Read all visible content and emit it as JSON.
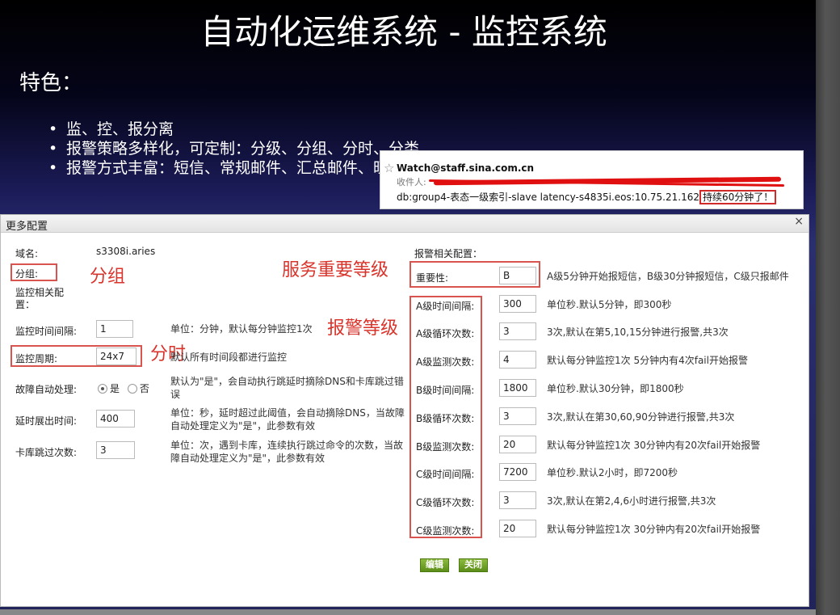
{
  "slide": {
    "title": "自动化运维系统 - 监控系统",
    "feature_heading": "特色：",
    "bullets": [
      "监、控、报分离",
      "报警策略多样化，可定制：分级、分组、分时、分类",
      "报警方式丰富：短信、常规邮件、汇总邮件、旺旺"
    ]
  },
  "email": {
    "star_icon": "star-icon",
    "from": "Watch@staff.sina.com.cn",
    "to_label": "收件人:",
    "body_prefix": "db:group4-表态一级索引-slave latency-s4835i.eos:10.75.21.162",
    "body_highlight": "持续60分钟了！"
  },
  "dialog": {
    "title": "更多配置",
    "close": "×",
    "left": {
      "domain_label": "域名:",
      "domain_value": "s3308i.aries",
      "group_label": "分组:",
      "monitor_section_label": "监控相关配置：",
      "rows": [
        {
          "label": "监控时间间隔:",
          "value": "1",
          "desc": "单位：分钟，默认每分钟监控1次"
        },
        {
          "label": "监控周期:",
          "value": "24x7",
          "desc": "默认所有时间段都进行监控"
        },
        {
          "label": "故障自动处理:",
          "radio_yes": "是",
          "radio_no": "否",
          "desc": "默认为\"是\"，会自动执行跳延时摘除DNS和卡库跳过错误"
        },
        {
          "label": "延时展出时间:",
          "value": "400",
          "desc": "单位：秒，延时超过此阈值，会自动摘除DNS，当故障自动处理定义为\"是\"，此参数有效"
        },
        {
          "label": "卡库跳过次数:",
          "value": "3",
          "desc": "单位：次，遇到卡库，连续执行跳过命令的次数，当故障自动处理定义为\"是\"，此参数有效"
        }
      ]
    },
    "right": {
      "alarm_section_label": "报警相关配置：",
      "importance_label": "重要性:",
      "importance_value": "B",
      "importance_desc": "A级5分钟开始报短信，B级30分钟报短信，C级只报邮件",
      "rows": [
        {
          "label": "A级时间间隔:",
          "value": "300",
          "desc": "单位秒.默认5分钟，即300秒"
        },
        {
          "label": "A级循环次数:",
          "value": "3",
          "desc": "3次,默认在第5,10,15分钟进行报警,共3次"
        },
        {
          "label": "A级监测次数:",
          "value": "4",
          "desc": "默认每分钟监控1次 5分钟内有4次fail开始报警"
        },
        {
          "label": "B级时间间隔:",
          "value": "1800",
          "desc": "单位秒.默认30分钟，即1800秒"
        },
        {
          "label": "B级循环次数:",
          "value": "3",
          "desc": "3次,默认在第30,60,90分钟进行报警,共3次"
        },
        {
          "label": "B级监测次数:",
          "value": "20",
          "desc": "默认每分钟监控1次 30分钟内有20次fail开始报警"
        },
        {
          "label": "C级时间间隔:",
          "value": "7200",
          "desc": "单位秒.默认2小时，即7200秒"
        },
        {
          "label": "C级循环次数:",
          "value": "3",
          "desc": "3次,默认在第2,4,6小时进行报警,共3次"
        },
        {
          "label": "C级监测次数:",
          "value": "20",
          "desc": "默认每分钟监控1次 30分钟内有20次fail开始报警"
        }
      ]
    },
    "buttons": {
      "edit": "编辑",
      "close": "关闭"
    }
  },
  "annotations": {
    "group": "分组",
    "importance": "服务重要等级",
    "alarm_level": "报警等级",
    "time_split": "分时"
  },
  "colors": {
    "annotation_red": "#d9342b",
    "button_green": "#6a9c22"
  }
}
